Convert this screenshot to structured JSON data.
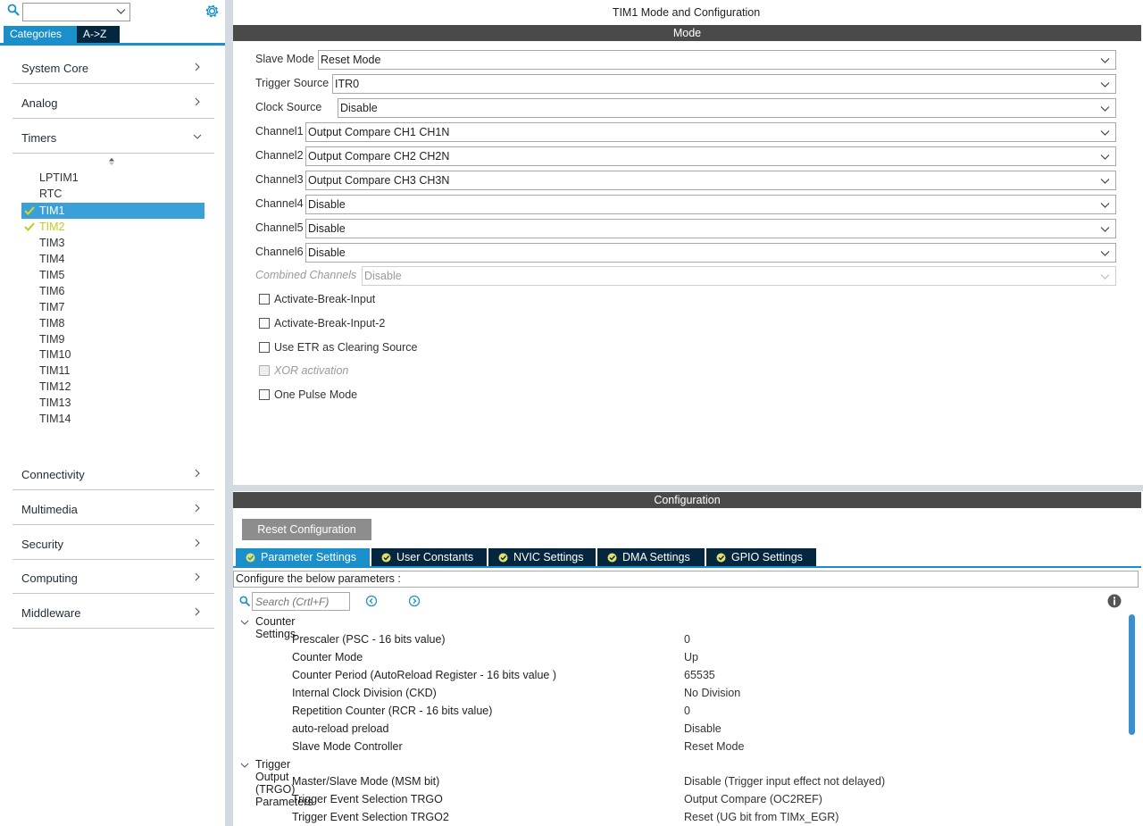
{
  "colors": {
    "accent": "#1a8fc9",
    "dark_tab": "#04273f",
    "bar": "#4a4a4a",
    "checked_ok": "#c8c820"
  },
  "left": {
    "tabs": {
      "categories": "Categories",
      "az": "A->Z"
    },
    "categories_top": [
      "System Core",
      "Analog",
      "Timers"
    ],
    "peripherals": [
      {
        "label": "LPTIM1",
        "checked": false
      },
      {
        "label": "RTC",
        "checked": false
      },
      {
        "label": "TIM1",
        "checked": true,
        "selected": true
      },
      {
        "label": "TIM2",
        "checked": true
      },
      {
        "label": "TIM3"
      },
      {
        "label": "TIM4"
      },
      {
        "label": "TIM5"
      },
      {
        "label": "TIM6"
      },
      {
        "label": "TIM7"
      },
      {
        "label": "TIM8"
      },
      {
        "label": "TIM9"
      },
      {
        "label": "TIM10"
      },
      {
        "label": "TIM11"
      },
      {
        "label": "TIM12"
      },
      {
        "label": "TIM13"
      },
      {
        "label": "TIM14"
      }
    ],
    "categories_bottom": [
      "Connectivity",
      "Multimedia",
      "Security",
      "Computing",
      "Middleware"
    ]
  },
  "right": {
    "title": "TIM1 Mode and Configuration",
    "mode_header": "Mode",
    "mode_fields": [
      {
        "label": "Slave Mode",
        "value": "Reset Mode"
      },
      {
        "label": "Trigger Source",
        "value": "ITR0"
      },
      {
        "label": "Clock Source",
        "value": "Disable"
      },
      {
        "label": "Channel1",
        "value": "Output Compare CH1 CH1N"
      },
      {
        "label": "Channel2",
        "value": "Output Compare CH2 CH2N"
      },
      {
        "label": "Channel3",
        "value": "Output Compare CH3 CH3N"
      },
      {
        "label": "Channel4",
        "value": "Disable"
      },
      {
        "label": "Channel5",
        "value": "Disable"
      },
      {
        "label": "Channel6",
        "value": "Disable"
      },
      {
        "label": "Combined Channels",
        "value": "Disable",
        "disabled": true
      }
    ],
    "checkboxes": [
      {
        "label": "Activate-Break-Input",
        "checked": false
      },
      {
        "label": "Activate-Break-Input-2",
        "checked": false
      },
      {
        "label": "Use ETR as Clearing Source",
        "checked": false
      },
      {
        "label": "XOR activation",
        "checked": false,
        "disabled": true
      },
      {
        "label": "One Pulse Mode",
        "checked": false
      }
    ],
    "config_header": "Configuration",
    "reset_button": "Reset Configuration",
    "config_tabs": [
      "Parameter Settings",
      "User Constants",
      "NVIC Settings",
      "DMA Settings",
      "GPIO Settings"
    ],
    "config_description": "Configure the below parameters :",
    "search_placeholder": "Search (Crtl+F)",
    "groups": [
      {
        "name": "Counter Settings",
        "params": [
          {
            "name": "Prescaler (PSC - 16 bits value)",
            "value": "0"
          },
          {
            "name": "Counter Mode",
            "value": "Up"
          },
          {
            "name": "Counter Period (AutoReload Register - 16 bits value )",
            "value": "65535"
          },
          {
            "name": "Internal Clock Division (CKD)",
            "value": "No Division"
          },
          {
            "name": "Repetition Counter (RCR - 16 bits value)",
            "value": "0"
          },
          {
            "name": "auto-reload preload",
            "value": "Disable"
          },
          {
            "name": "Slave Mode Controller",
            "value": "Reset Mode"
          }
        ]
      },
      {
        "name": "Trigger Output (TRGO) Parameters",
        "params": [
          {
            "name": "Master/Slave Mode (MSM bit)",
            "value": "Disable (Trigger input effect not delayed)"
          },
          {
            "name": "Trigger Event Selection TRGO",
            "value": "Output Compare (OC2REF)"
          },
          {
            "name": "Trigger Event Selection TRGO2",
            "value": "Reset (UG bit from TIMx_EGR)"
          }
        ]
      }
    ]
  }
}
